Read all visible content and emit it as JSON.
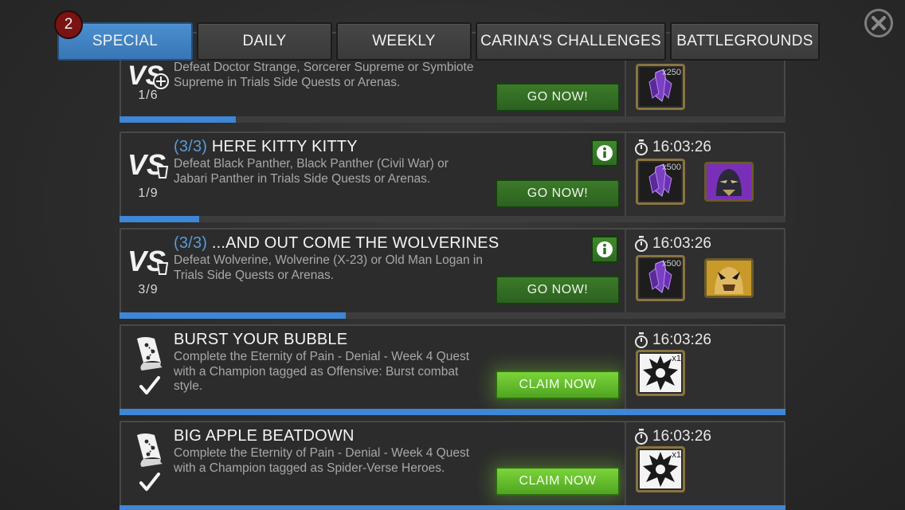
{
  "tabs": [
    {
      "label": "SPECIAL",
      "active": true
    },
    {
      "label": "DAILY",
      "active": false
    },
    {
      "label": "WEEKLY",
      "active": false
    },
    {
      "label": "CARINA'S CHALLENGES",
      "active": false
    },
    {
      "label": "BATTLEGROUNDS",
      "active": false
    }
  ],
  "badge_count": "2",
  "colors": {
    "accent_blue": "#3e86d6",
    "go_green": "#3c7a28",
    "claim_green": "#7cd43a",
    "reward_border": "#8a7440"
  },
  "quests": [
    {
      "step": "",
      "title": "",
      "desc": "Defeat Doctor Strange, Sorcerer Supreme or Symbiote Supreme in Trials Side Quests or Arenas.",
      "progress_text": "1/6",
      "progress": 0.175,
      "button": "GO NOW!",
      "button_kind": "go",
      "icon": "vs-icon",
      "timer": "",
      "reward_qty": "x250",
      "reward_icon": "crystal-shard-icon",
      "has_champ": false
    },
    {
      "step": "(3/3)",
      "title": "HERE KITTY KITTY",
      "desc": "Defeat Black Panther, Black Panther (Civil War) or Jabari Panther in Trials Side Quests or Arenas.",
      "progress_text": "1/9",
      "progress": 0.12,
      "button": "GO NOW!",
      "button_kind": "go",
      "icon": "vs-icon",
      "timer": "16:03:26",
      "reward_qty": "x500",
      "reward_icon": "crystal-shard-icon",
      "has_champ": true,
      "champ_icon": "champion-portrait-icon"
    },
    {
      "step": "(3/3)",
      "title": "...AND OUT COME THE WOLVERINES",
      "desc": "Defeat Wolverine, Wolverine (X-23) or Old Man Logan in Trials Side Quests or Arenas.",
      "progress_text": "3/9",
      "progress": 0.34,
      "button": "GO NOW!",
      "button_kind": "go",
      "icon": "vs-icon",
      "timer": "16:03:26",
      "reward_qty": "x500",
      "reward_icon": "crystal-shard-icon",
      "has_champ": true,
      "champ_icon": "champion-portrait-icon"
    },
    {
      "step": "",
      "title": "BURST YOUR BUBBLE",
      "desc": "Complete the Eternity of Pain - Denial - Week 4 Quest with a Champion tagged as Offensive: Burst combat style.",
      "progress_text": "",
      "progress": 1.0,
      "button": "CLAIM NOW",
      "button_kind": "claim",
      "icon": "quest-map-icon",
      "timer": "16:03:26",
      "reward_qty": "x1",
      "reward_icon": "splash-crystal-icon",
      "has_champ": false
    },
    {
      "step": "",
      "title": "BIG APPLE BEATDOWN",
      "desc": "Complete the Eternity of Pain - Denial - Week 4 Quest with a Champion tagged as Spider-Verse Heroes.",
      "progress_text": "",
      "progress": 1.0,
      "button": "CLAIM NOW",
      "button_kind": "claim",
      "icon": "quest-map-icon",
      "timer": "16:03:26",
      "reward_qty": "x1",
      "reward_icon": "splash-crystal-icon",
      "has_champ": false
    }
  ]
}
